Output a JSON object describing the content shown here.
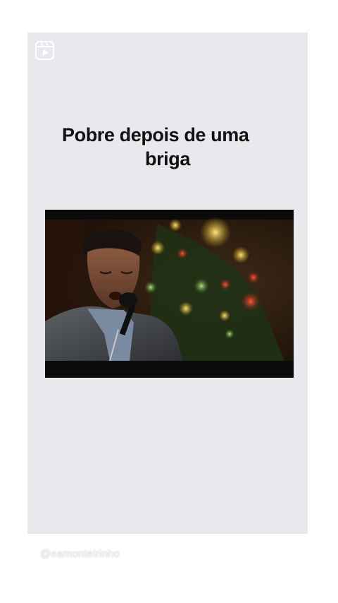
{
  "post": {
    "title_line1": "Pobre depois de uma",
    "title_line2": "briga",
    "watermark": "@eamonteirinho"
  },
  "icons": {
    "reel": "reel-icon"
  },
  "colors": {
    "card_background": "#e9e8ec",
    "page_background": "#ffffff",
    "title_text": "#111111"
  }
}
